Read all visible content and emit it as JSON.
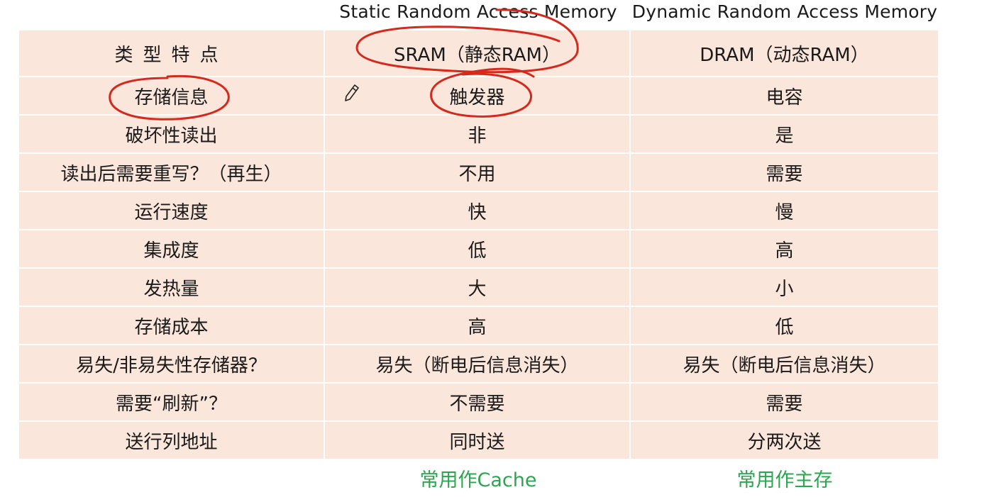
{
  "top_labels": {
    "sram": "Static Random Access Memory",
    "dram": "Dynamic Random Access Memory"
  },
  "header": {
    "feature": "类型特点",
    "sram": "SRAM（静态RAM）",
    "dram": "DRAM（动态RAM）"
  },
  "rows": [
    {
      "feature": "存储信息",
      "sram": "触发器",
      "dram": "电容"
    },
    {
      "feature": "破坏性读出",
      "sram": "非",
      "dram": "是"
    },
    {
      "feature": "读出后需要重写？（再生）",
      "sram": "不用",
      "dram": "需要"
    },
    {
      "feature": "运行速度",
      "sram": "快",
      "dram": "慢"
    },
    {
      "feature": "集成度",
      "sram": "低",
      "dram": "高"
    },
    {
      "feature": "发热量",
      "sram": "大",
      "dram": "小"
    },
    {
      "feature": "存储成本",
      "sram": "高",
      "dram": "低"
    },
    {
      "feature": "易失/非易失性存储器？",
      "sram": "易失（断电后信息消失）",
      "dram": "易失（断电后信息消失）"
    },
    {
      "feature": "需要“刷新”？",
      "sram": "不需要",
      "dram": "需要"
    },
    {
      "feature": "送行列地址",
      "sram": "同时送",
      "dram": "分两次送"
    }
  ],
  "footer": {
    "sram": "常用作Cache",
    "dram": "常用作主存"
  },
  "colors": {
    "cell_background": "#fbe6dc",
    "footer_text": "#2aa64f",
    "annotation_ink": "#d32a1e"
  },
  "icons": [
    "pencil-cursor-icon"
  ]
}
